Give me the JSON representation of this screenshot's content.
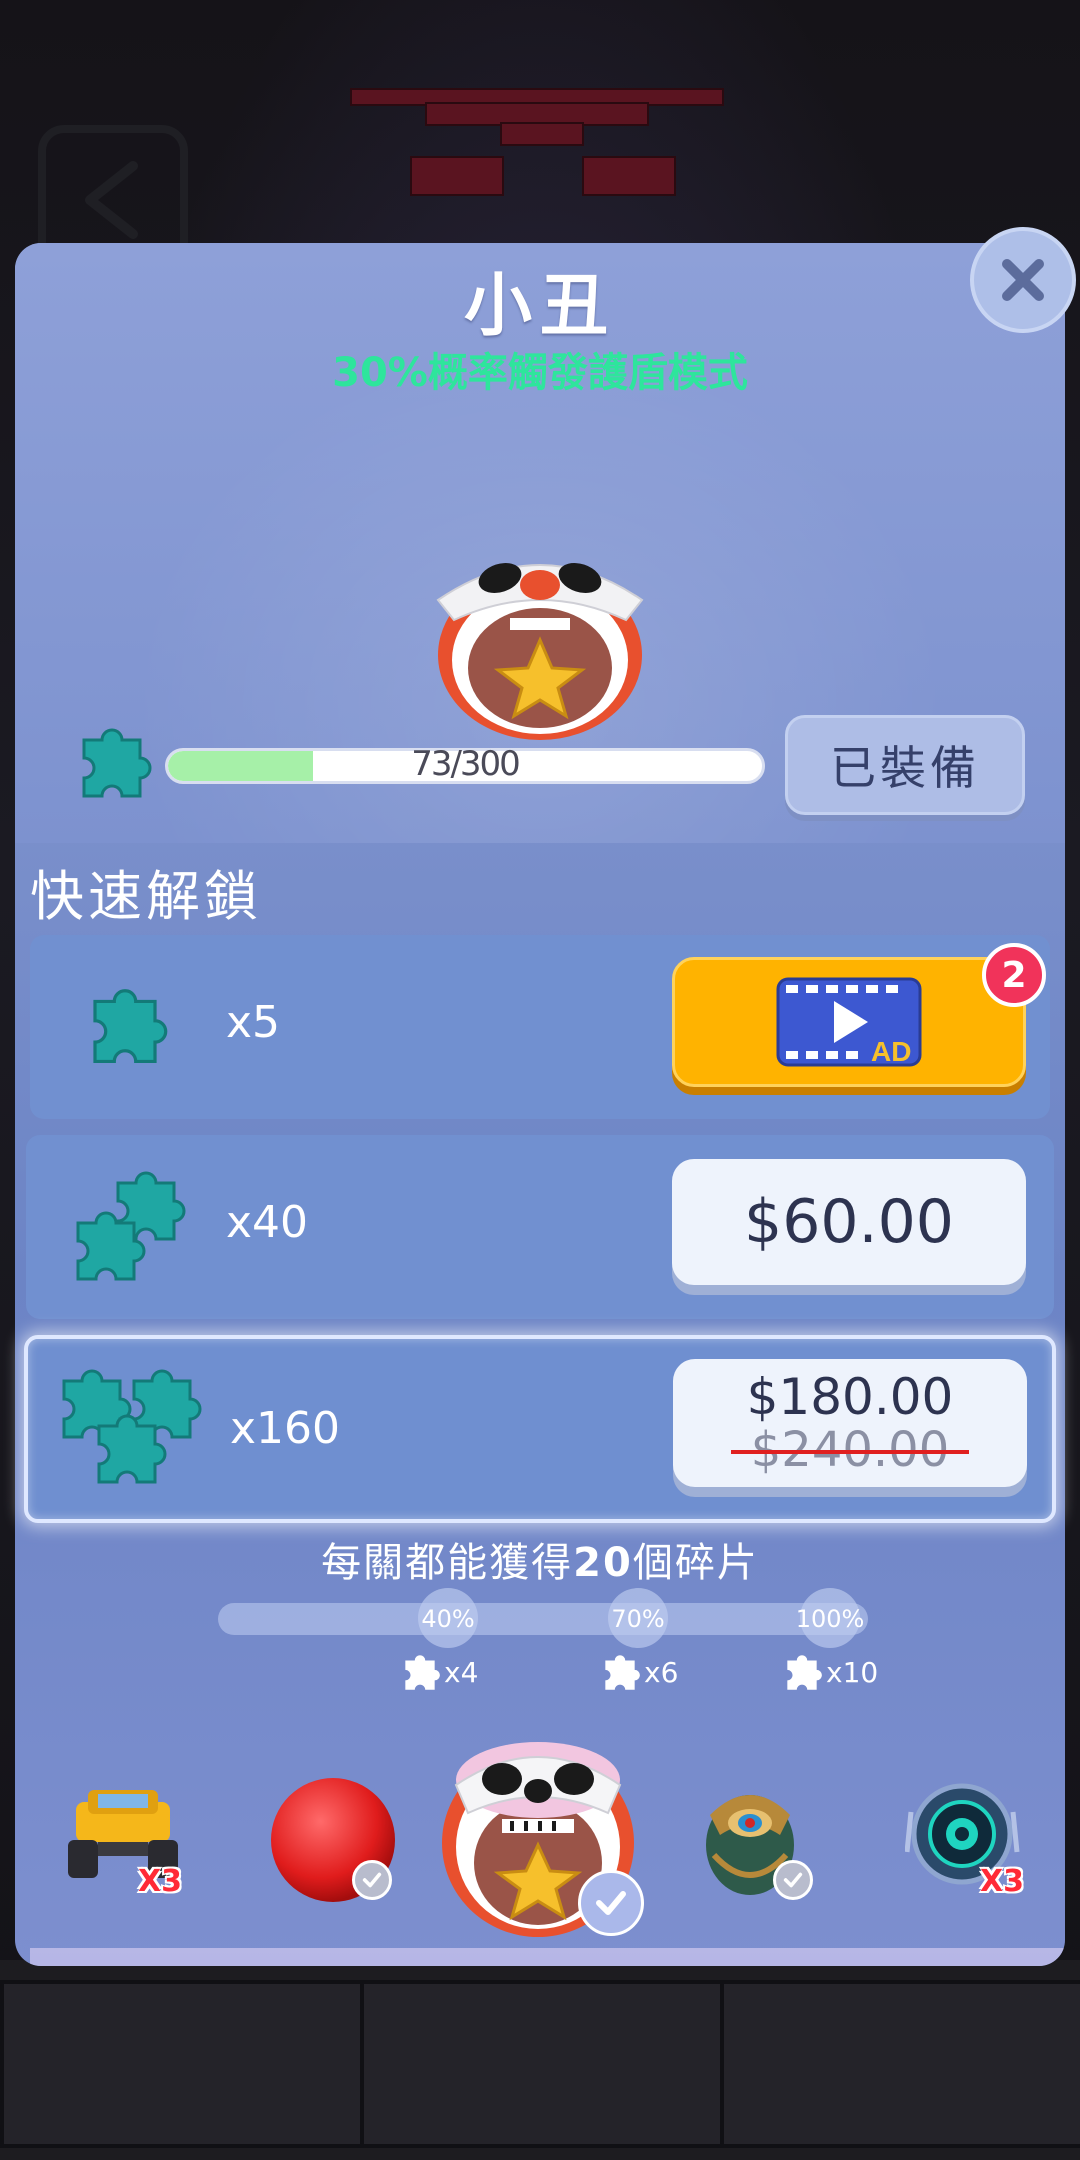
{
  "skin": {
    "name": "小丑",
    "ability_pct": "30%",
    "ability_text": "概率觸發護盾模式",
    "progress_current": 73,
    "progress_total": 300,
    "progress_text": "73/300",
    "equip_label": "已裝備"
  },
  "quick_unlock": {
    "title": "快速解鎖",
    "offers": [
      {
        "qty": "x5",
        "type": "ad",
        "ad_label": "AD",
        "badge": "2"
      },
      {
        "qty": "x40",
        "type": "price",
        "price": "$60.00"
      },
      {
        "qty": "x160",
        "type": "price",
        "price": "$180.00",
        "old_price": "$240.00"
      }
    ]
  },
  "level_hint": {
    "prefix": "每關都能獲得",
    "amount": "20",
    "suffix": "個碎片"
  },
  "milestones": [
    {
      "pct": "40%",
      "reward": "x4"
    },
    {
      "pct": "70%",
      "reward": "x6"
    },
    {
      "pct": "100%",
      "reward": "x10"
    }
  ],
  "skin_bar": {
    "items": [
      {
        "name": "monster-truck",
        "badge": "X3"
      },
      {
        "name": "red-ball",
        "owned": true
      },
      {
        "name": "clown-ball",
        "selected": true
      },
      {
        "name": "scarab",
        "owned": true
      },
      {
        "name": "cyber-eye",
        "badge": "X3"
      }
    ]
  },
  "colors": {
    "ability": "#2ee59c",
    "ad_button": "#ffb300",
    "badge": "#f1335a",
    "progress_fill": "#a6f0a8",
    "strike": "#e02020"
  }
}
